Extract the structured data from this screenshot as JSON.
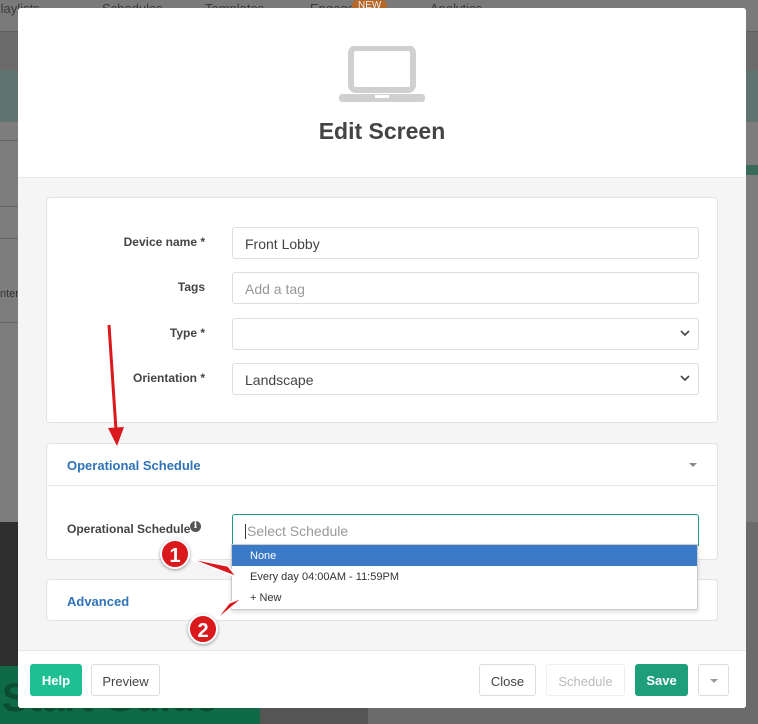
{
  "background": {
    "nav": [
      "Playlists",
      "Schedules",
      "Templates",
      "Engage",
      "Analytics"
    ],
    "nav_badge": "NEW",
    "left_text": "nter",
    "banner_text": "Start Guide"
  },
  "modal": {
    "title": "Edit Screen",
    "icon": "laptop-icon",
    "form": {
      "device_name_label": "Device name *",
      "device_name_value": "Front Lobby",
      "tags_label": "Tags",
      "tags_placeholder": "Add a tag",
      "type_label": "Type *",
      "type_value": "",
      "orientation_label": "Orientation *",
      "orientation_value": "Landscape"
    },
    "operational_schedule": {
      "section_title": "Operational Schedule",
      "field_label": "Operational Schedule",
      "placeholder": "Select Schedule",
      "options": [
        "None",
        "Every day 04:00AM - 11:59PM",
        "+ New"
      ],
      "selected_index": 0
    },
    "advanced_title": "Advanced",
    "footer": {
      "help": "Help",
      "preview": "Preview",
      "close": "Close",
      "schedule": "Schedule",
      "save": "Save"
    }
  },
  "annotations": {
    "markers": [
      "1",
      "2"
    ],
    "color": "#d9191c"
  },
  "colors": {
    "accent_green": "#1f9e7b",
    "link_blue": "#2f73b8",
    "selected_blue": "#3b7ac6"
  }
}
